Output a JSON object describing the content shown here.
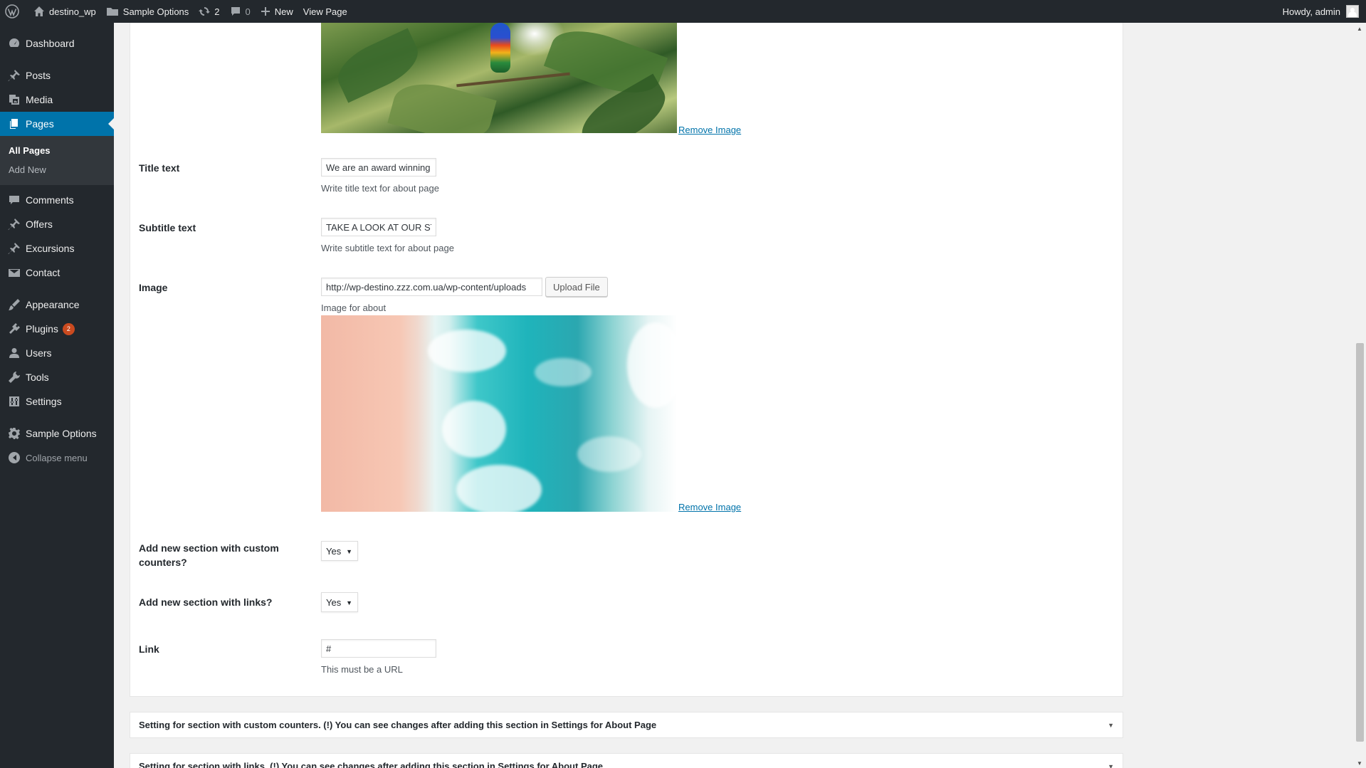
{
  "adminbar": {
    "site_name": "destino_wp",
    "sample_options": "Sample Options",
    "updates_count": "2",
    "comments_count": "0",
    "new_label": "New",
    "view_page": "View Page",
    "howdy": "Howdy, admin"
  },
  "menu": {
    "dashboard": "Dashboard",
    "posts": "Posts",
    "media": "Media",
    "pages": "Pages",
    "all_pages": "All Pages",
    "add_new": "Add New",
    "comments": "Comments",
    "offers": "Offers",
    "excursions": "Excursions",
    "contact": "Contact",
    "appearance": "Appearance",
    "plugins": "Plugins",
    "plugins_badge": "2",
    "users": "Users",
    "tools": "Tools",
    "settings": "Settings",
    "sample_options": "Sample Options",
    "collapse": "Collapse menu",
    "active_color": "#0073aa"
  },
  "form": {
    "remove_image": "Remove Image",
    "title_text": {
      "label": "Title text",
      "value": "We are an award winning",
      "description": "Write title text for about page"
    },
    "subtitle_text": {
      "label": "Subtitle text",
      "value": "TAKE A LOOK AT OUR STORY",
      "description": "Write subtitle text for about page"
    },
    "image": {
      "label": "Image",
      "value": "http://wp-destino.zzz.com.ua/wp-content/uploads",
      "upload_button": "Upload File",
      "description": "Image for about"
    },
    "counters_section": {
      "label": "Add new section with custom counters?",
      "value": "Yes"
    },
    "links_section": {
      "label": "Add new section with links?",
      "value": "Yes"
    },
    "link": {
      "label": "Link",
      "value": "#",
      "description": "This must be a URL"
    }
  },
  "sections": {
    "counters_header": "Setting for section with custom counters. (!) You can see changes after adding this section in Settings for About Page",
    "links_header": "Setting for section with links. (!) You can see changes after adding this section in Settings for About Page"
  }
}
